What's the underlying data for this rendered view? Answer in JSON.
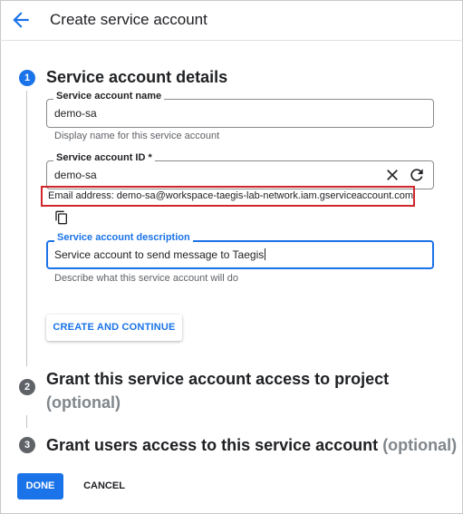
{
  "header": {
    "title": "Create service account"
  },
  "steps": [
    {
      "number": "1",
      "title": "Service account details",
      "optional": ""
    },
    {
      "number": "2",
      "title": "Grant this service account access to project",
      "optional": "(optional)"
    },
    {
      "number": "3",
      "title": "Grant users access to this service account",
      "optional": "(optional)"
    }
  ],
  "form": {
    "name": {
      "label": "Service account name",
      "value": "demo-sa",
      "hint": "Display name for this service account"
    },
    "id": {
      "label": "Service account ID *",
      "value": "demo-sa"
    },
    "email": {
      "text": "Email address: demo-sa@workspace-taegis-lab-network.iam.gserviceaccount.com"
    },
    "description": {
      "label": "Service account description",
      "value": "Service account to send message to Taegis",
      "hint": "Describe what this service account will do"
    }
  },
  "buttons": {
    "create_continue": "CREATE AND CONTINUE",
    "done": "DONE",
    "cancel": "CANCEL"
  },
  "icons": {
    "back": "arrow-back-icon",
    "clear": "close-icon",
    "regenerate": "refresh-icon",
    "copy": "copy-icon"
  },
  "colors": {
    "accent": "#1a73e8",
    "highlight_border": "#d2262e",
    "inactive_step": "#5f6368",
    "optional_text": "#80868b"
  }
}
